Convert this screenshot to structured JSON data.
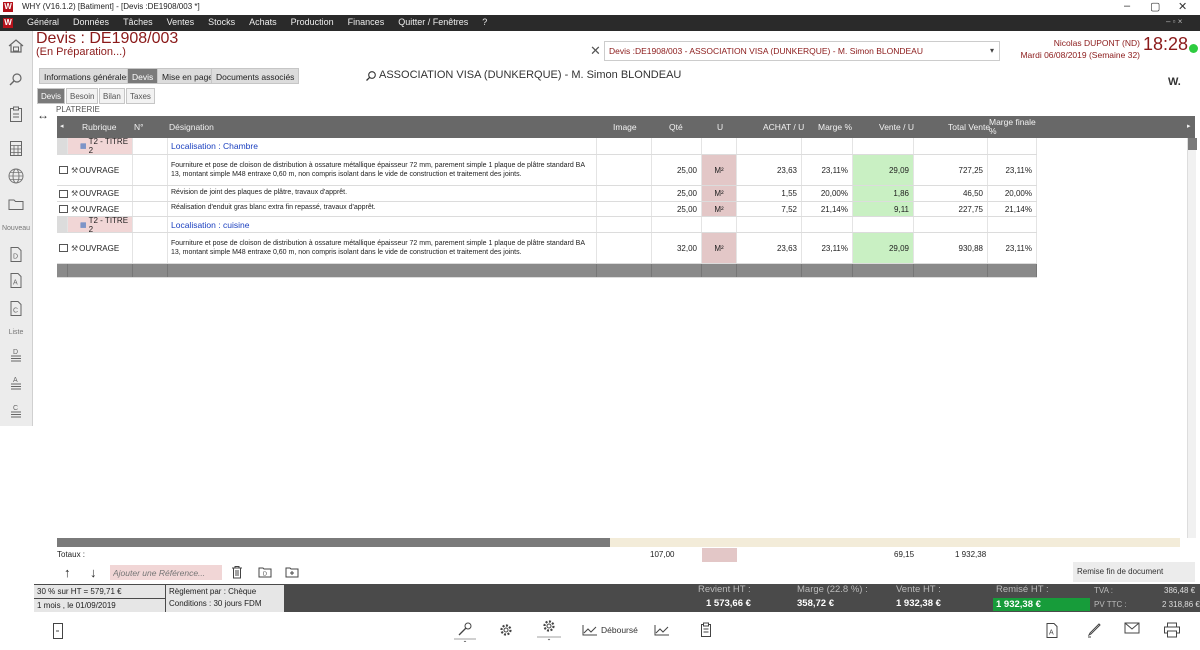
{
  "window": {
    "title": "WHY (V16.1.2)  [Batiment] - [Devis :DE1908/003 *]",
    "minimize": "–",
    "maximize": "▢",
    "close": "✕",
    "inner_controls": "– ▫ ×"
  },
  "menu": [
    "Général",
    "Données",
    "Tâches",
    "Ventes",
    "Stocks",
    "Achats",
    "Production",
    "Finances",
    "Quitter / Fenêtres",
    "?"
  ],
  "sidebar": {
    "nouveau_label": "Nouveau",
    "liste_label": "Liste"
  },
  "header": {
    "doc_title": "Devis : DE1908/003",
    "doc_status": "(En Préparation...)",
    "close_glyph": "✕",
    "doc_select_value": "Devis :DE1908/003 - ASSOCIATION VISA  (DUNKERQUE) - M. Simon BLONDEAU",
    "user_name": "Nicolas DUPONT (ND)",
    "user_date": "Mardi 06/08/2019 (Semaine 32)",
    "clock": "18:28",
    "online_color": "#2ecc40"
  },
  "tabs": [
    "Informations générales",
    "Devis",
    "Mise en page",
    "Documents associés"
  ],
  "active_tab": "Devis",
  "subtabs": [
    "Devis",
    "Besoin",
    "Bilan",
    "Taxes"
  ],
  "active_subtab": "Devis",
  "client_line": "ASSOCIATION VISA  (DUNKERQUE) - M. Simon BLONDEAU",
  "brand": "W.",
  "lot_label": "PLATRERIE",
  "columns": {
    "rubrique": "Rubrique",
    "num": "N°",
    "designation": "Désignation",
    "image": "Image",
    "qte": "Qté",
    "unit": "U",
    "achat": "ACHAT / U",
    "marge": "Marge %",
    "vente": "Vente / U",
    "total": "Total Vente",
    "marge_finale": "Marge finale %"
  },
  "rows": [
    {
      "type": "titre",
      "rubrique": "T2 - TITRE 2",
      "designation": "Localisation : Chambre"
    },
    {
      "type": "ouvrage",
      "rubrique": "OUVRAGE",
      "designation": "Fourniture et pose de cloison de distribution à ossature métallique épaisseur 72 mm, parement simple 1 plaque de plâtre standard BA 13, montant simple M48 entraxe 0,60 m, non compris isolant dans le vide de construction et traitement des joints.",
      "qte": "25,00",
      "unit": "M²",
      "achat": "23,63",
      "marge": "23,11%",
      "vente": "29,09",
      "total": "727,25",
      "marge_finale": "23,11%"
    },
    {
      "type": "ouvrage",
      "rubrique": "OUVRAGE",
      "designation": "Révision de joint des plaques de plâtre, travaux d'apprêt.",
      "qte": "25,00",
      "unit": "M²",
      "achat": "1,55",
      "marge": "20,00%",
      "vente": "1,86",
      "total": "46,50",
      "marge_finale": "20,00%"
    },
    {
      "type": "ouvrage",
      "rubrique": "OUVRAGE",
      "designation": "Réalisation d'enduit gras blanc extra fin repassé, travaux d'apprêt.",
      "qte": "25,00",
      "unit": "M²",
      "achat": "7,52",
      "marge": "21,14%",
      "vente": "9,11",
      "total": "227,75",
      "marge_finale": "21,14%"
    },
    {
      "type": "titre",
      "rubrique": "T2 - TITRE 2",
      "designation": "Localisation : cuisine"
    },
    {
      "type": "ouvrage",
      "rubrique": "OUVRAGE",
      "designation": "Fourniture et pose de cloison de distribution à ossature métallique épaisseur 72 mm, parement simple 1 plaque de plâtre standard BA 13, montant simple M48 entraxe 0,60 m, non compris isolant dans le vide de construction et traitement des joints.",
      "qte": "32,00",
      "unit": "M²",
      "achat": "23,63",
      "marge": "23,11%",
      "vente": "29,09",
      "total": "930,88",
      "marge_finale": "23,11%"
    }
  ],
  "totaux": {
    "label": "Totaux :",
    "qte": "107,00",
    "vente": "69,15",
    "total": "1 932,38"
  },
  "toolbar": {
    "ref_placeholder": "Ajouter une Référence...",
    "remise_doc": "Remise fin de document"
  },
  "footer": {
    "acompte": "30 % sur HT =   579,71 €",
    "echeance": "1 mois , le 01/09/2019",
    "reglement": "Règlement par : Chèque",
    "conditions": "Conditions : 30 jours FDM",
    "revient_label": "Revient HT :",
    "revient_value": "1 573,66 €",
    "marge_label": "Marge (22.8 %) :",
    "marge_value": "358,72 €",
    "vente_label": "Vente HT :",
    "vente_value": "1 932,38 €",
    "remise_label": "Remisé HT :",
    "remise_value": "1 932,38 €",
    "tva_label": "TVA :",
    "tva_value": "386,48 €",
    "pvttc_label": "PV TTC :",
    "pvttc_value": "2 318,86 €"
  },
  "actions": {
    "debourse_label": "Déboursé"
  }
}
